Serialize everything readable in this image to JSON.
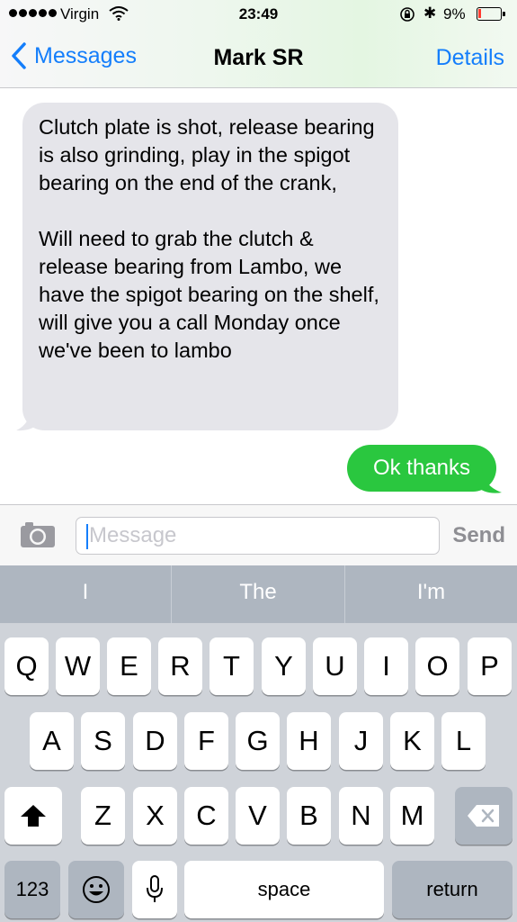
{
  "status_bar": {
    "carrier": "Virgin",
    "time": "23:49",
    "battery_percent": "9%",
    "icons": [
      "signal-dots",
      "wifi-icon",
      "rotation-lock-icon",
      "bluetooth-icon",
      "battery-icon"
    ]
  },
  "nav": {
    "back_label": "Messages",
    "title": "Mark SR",
    "details_label": "Details"
  },
  "messages": [
    {
      "direction": "incoming",
      "text": "Clutch plate is shot, release bearing is also grinding, play in the spigot bearing on the end of the crank,\n\nWill need to grab the clutch & release bearing from Lambo, we have the spigot bearing on the shelf, will give you a call Monday once we've been to lambo"
    },
    {
      "direction": "outgoing",
      "text": "Ok thanks"
    }
  ],
  "composer": {
    "placeholder": "Message",
    "send_label": "Send"
  },
  "keyboard": {
    "predictions": [
      "I",
      "The",
      "I'm"
    ],
    "row1": [
      "Q",
      "W",
      "E",
      "R",
      "T",
      "Y",
      "U",
      "I",
      "O",
      "P"
    ],
    "row2": [
      "A",
      "S",
      "D",
      "F",
      "G",
      "H",
      "J",
      "K",
      "L"
    ],
    "row3": [
      "Z",
      "X",
      "C",
      "V",
      "B",
      "N",
      "M"
    ],
    "numbers_label": "123",
    "space_label": "space",
    "return_label": "return"
  },
  "colors": {
    "accent_blue": "#147efb",
    "outgoing_bubble": "#2ac73f",
    "incoming_bubble": "#e5e5ea",
    "battery_low": "#ff3b30"
  }
}
